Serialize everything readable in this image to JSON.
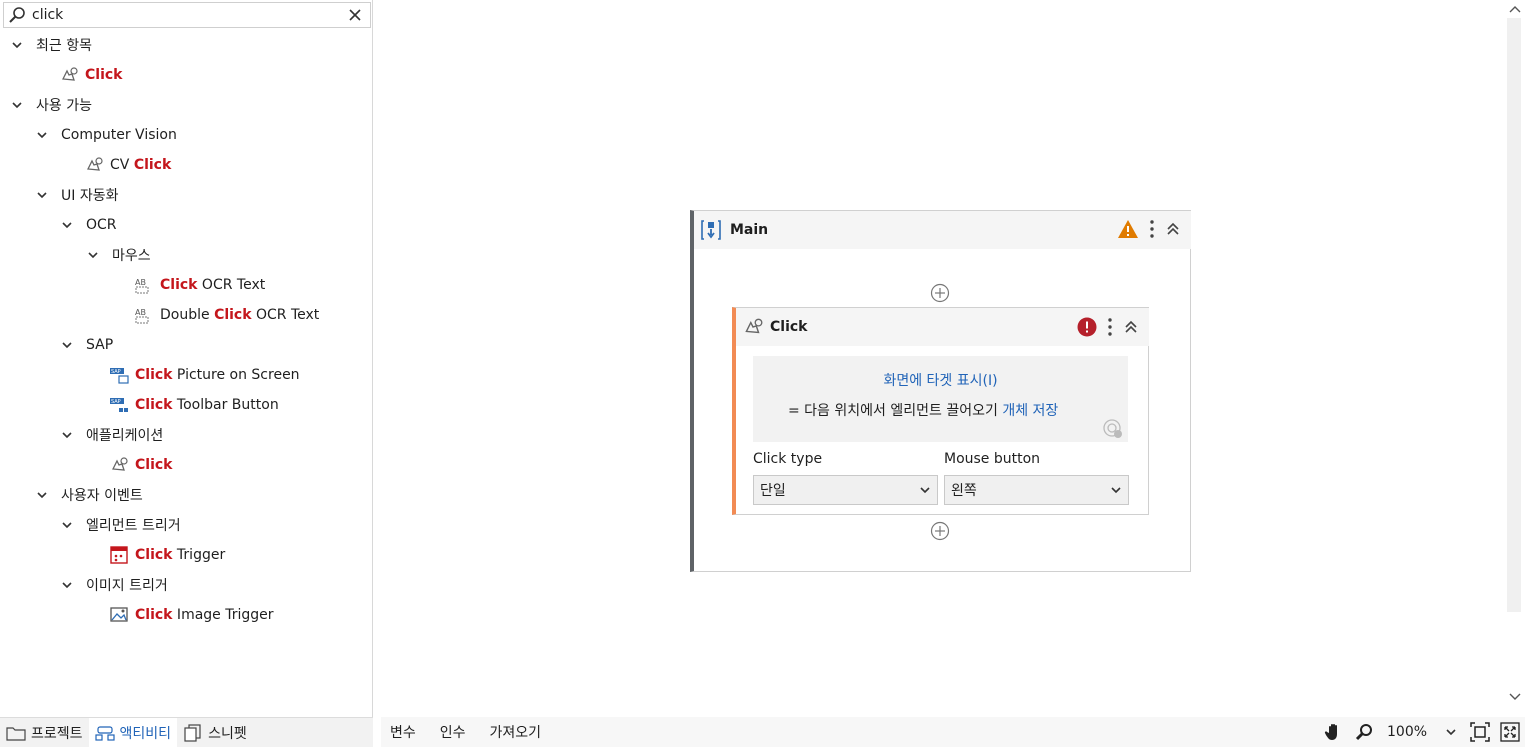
{
  "search": {
    "value": "click"
  },
  "tree": {
    "recent": {
      "label": "최근 항목",
      "items": [
        {
          "hl": "Click",
          "rest": ""
        }
      ]
    },
    "available": {
      "label": "사용 가능"
    },
    "computer_vision": {
      "label": "Computer Vision",
      "item": {
        "pre": "CV ",
        "hl": "Click",
        "rest": ""
      }
    },
    "ui_automation": {
      "label": "UI 자동화"
    },
    "ocr": {
      "label": "OCR"
    },
    "mouse": {
      "label": "마우스"
    },
    "click_ocr_text": {
      "pre": "",
      "hl": "Click",
      "rest": " OCR Text"
    },
    "double_click_ocr_text": {
      "pre": "Double ",
      "hl": "Click",
      "rest": " OCR Text"
    },
    "sap": {
      "label": "SAP"
    },
    "click_picture": {
      "hl": "Click",
      "rest": " Picture on Screen"
    },
    "click_toolbar": {
      "hl": "Click",
      "rest": " Toolbar Button"
    },
    "application": {
      "label": "애플리케이션"
    },
    "app_click": {
      "hl": "Click",
      "rest": ""
    },
    "user_events": {
      "label": "사용자 이벤트"
    },
    "element_trigger": {
      "label": "엘리먼트 트리거"
    },
    "click_trigger": {
      "hl": "Click",
      "rest": " Trigger"
    },
    "image_trigger": {
      "label": "이미지 트리거"
    },
    "click_image_trigger": {
      "hl": "Click",
      "rest": " Image Trigger"
    }
  },
  "left_tabs": [
    {
      "label": "프로젝트"
    },
    {
      "label": "액티비티"
    },
    {
      "label": "스니펫"
    }
  ],
  "main": {
    "title": "Main"
  },
  "click_activity": {
    "title": "Click",
    "show_target": "화면에 타겟 표시(I)",
    "drag_text": "= 다음 위치에서 엘리먼트 끌어오기 ",
    "drag_link": "개체 저장",
    "click_type_label": "Click type",
    "click_type_value": "단일",
    "mouse_button_label": "Mouse button",
    "mouse_button_value": "왼쪽"
  },
  "bottom_tabs": [
    {
      "label": "변수"
    },
    {
      "label": "인수"
    },
    {
      "label": "가져오기"
    }
  ],
  "zoom": {
    "value": "100%"
  },
  "colors": {
    "highlight": "#c4161c",
    "link": "#2164b8",
    "activity_accent": "#f28b54",
    "warning": "#e07b00",
    "error": "#b5202b"
  }
}
